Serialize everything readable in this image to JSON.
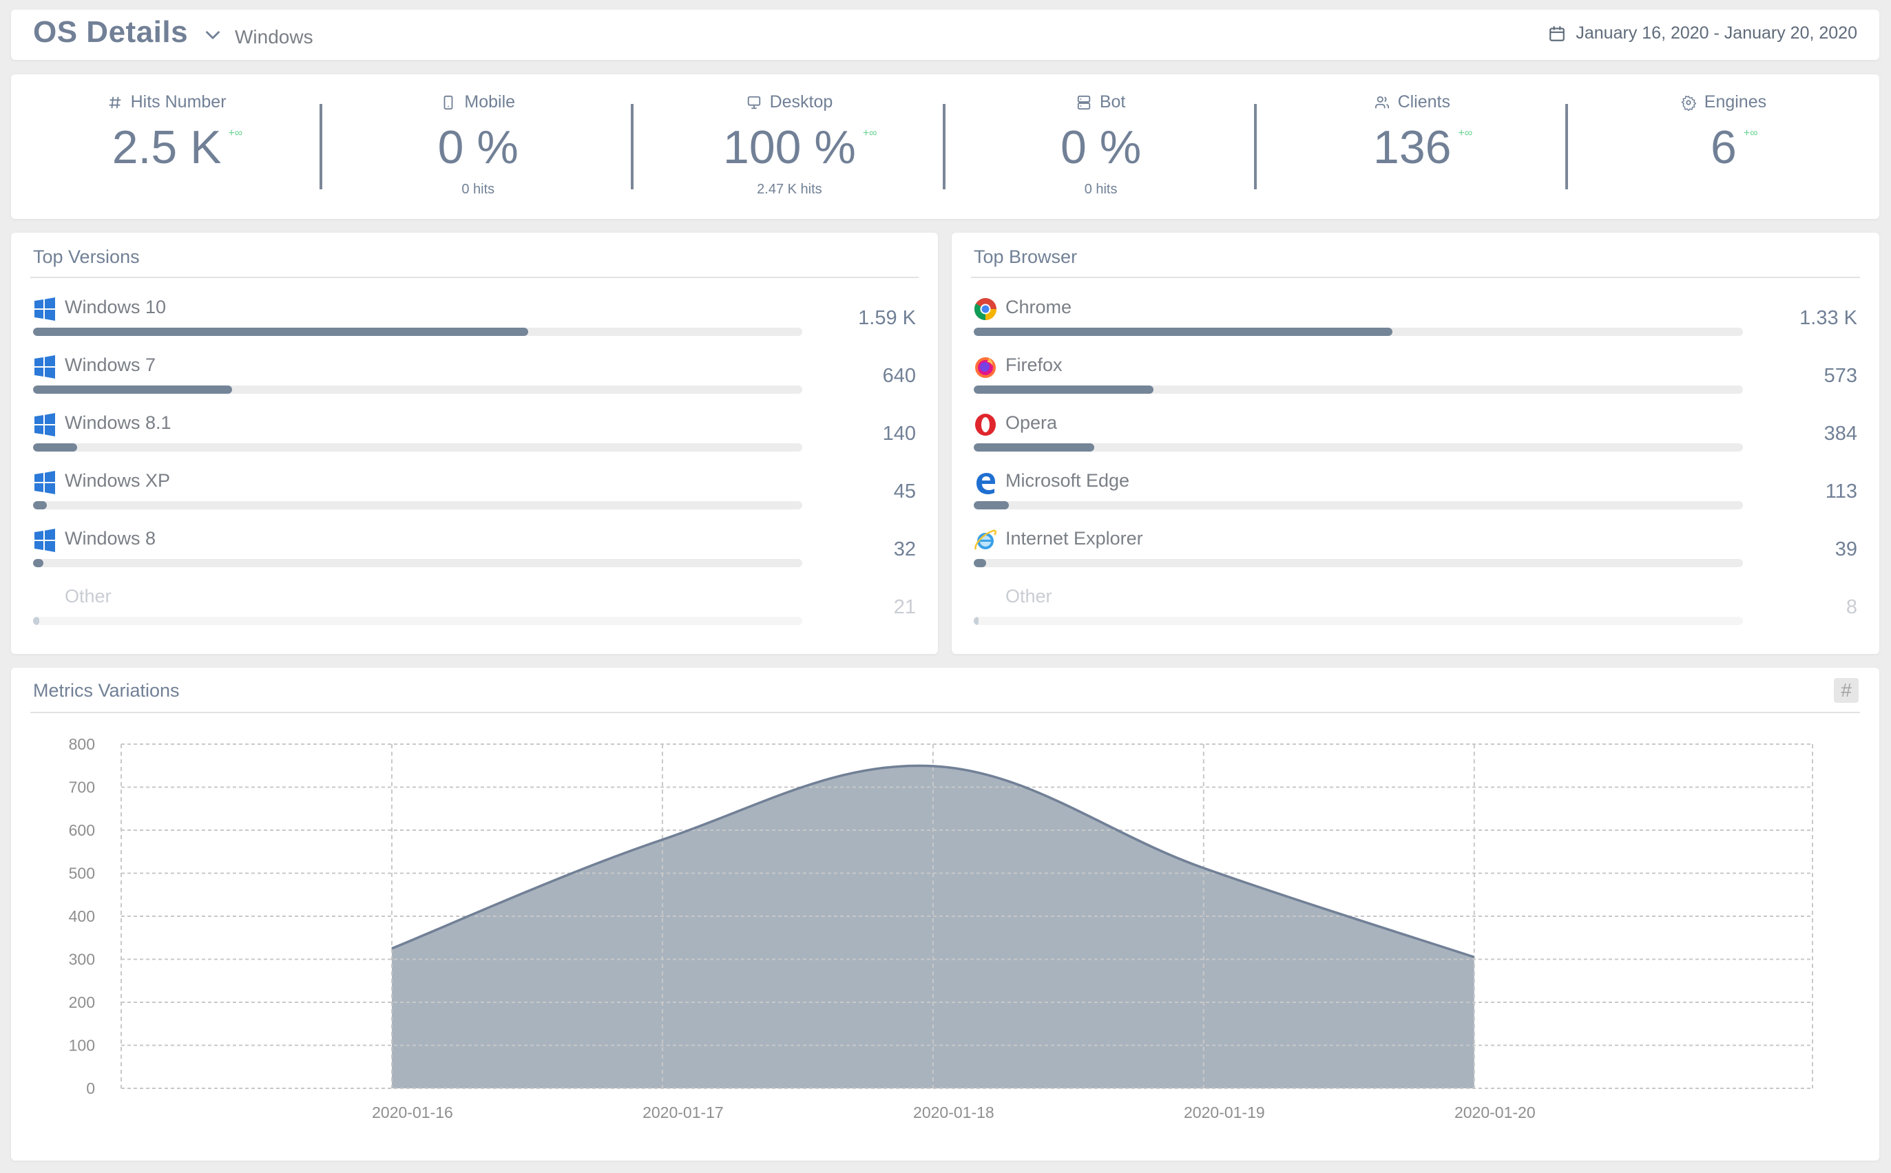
{
  "header": {
    "title": "OS Details",
    "selected_os": "Windows",
    "date_range": "January 16, 2020 - January 20, 2020"
  },
  "stats": [
    {
      "icon": "hash-icon",
      "label": "Hits Number",
      "value": "2.5 K",
      "trend": "+∞",
      "sub": ""
    },
    {
      "icon": "mobile-icon",
      "label": "Mobile",
      "value": "0 %",
      "trend": "",
      "sub": "0  hits"
    },
    {
      "icon": "desktop-icon",
      "label": "Desktop",
      "value": "100 %",
      "trend": "+∞",
      "sub": "2.47 K hits"
    },
    {
      "icon": "server-icon",
      "label": "Bot",
      "value": "0 %",
      "trend": "",
      "sub": "0  hits"
    },
    {
      "icon": "users-icon",
      "label": "Clients",
      "value": "136",
      "trend": "+∞",
      "sub": ""
    },
    {
      "icon": "gear-icon",
      "label": "Engines",
      "value": "6",
      "trend": "+∞",
      "sub": ""
    }
  ],
  "top_versions": {
    "title": "Top Versions",
    "items": [
      {
        "icon": "windows-icon",
        "label": "Windows 10",
        "value": "1.59 K",
        "fraction": 0.644
      },
      {
        "icon": "windows-icon",
        "label": "Windows 7",
        "value": "640",
        "fraction": 0.259
      },
      {
        "icon": "windows-icon",
        "label": "Windows 8.1",
        "value": "140",
        "fraction": 0.057
      },
      {
        "icon": "windows-icon",
        "label": "Windows XP",
        "value": "45",
        "fraction": 0.018
      },
      {
        "icon": "windows-icon",
        "label": "Windows 8",
        "value": "32",
        "fraction": 0.013
      },
      {
        "icon": "",
        "label": "Other",
        "value": "21",
        "fraction": 0.008,
        "other": true
      }
    ]
  },
  "top_browser": {
    "title": "Top Browser",
    "items": [
      {
        "icon": "chrome-icon",
        "label": "Chrome",
        "value": "1.33 K",
        "fraction": 0.544
      },
      {
        "icon": "firefox-icon",
        "label": "Firefox",
        "value": "573",
        "fraction": 0.234
      },
      {
        "icon": "opera-icon",
        "label": "Opera",
        "value": "384",
        "fraction": 0.157
      },
      {
        "icon": "edge-icon",
        "label": "Microsoft Edge",
        "value": "113",
        "fraction": 0.046
      },
      {
        "icon": "ie-icon",
        "label": "Internet Explorer",
        "value": "39",
        "fraction": 0.016
      },
      {
        "icon": "",
        "label": "Other",
        "value": "8",
        "fraction": 0.003,
        "other": true
      }
    ]
  },
  "metrics": {
    "title": "Metrics Variations",
    "toggle_label": "#"
  },
  "colors": {
    "accent": "#718096",
    "bar_fill": "#758598",
    "area_fill": "#a9b3be",
    "area_line": "#718096",
    "trend": "#68d391",
    "windows_blue": "#2b79d8"
  },
  "chart_data": {
    "type": "area",
    "title": "Metrics Variations",
    "xlabel": "",
    "ylabel": "",
    "categories": [
      "2020-01-16",
      "2020-01-17",
      "2020-01-18",
      "2020-01-19",
      "2020-01-20"
    ],
    "series": [
      {
        "name": "Hits",
        "values": [
          325,
          578,
          749,
          512,
          305
        ]
      }
    ],
    "ylim": [
      0,
      800
    ],
    "yticks": [
      0,
      100,
      200,
      300,
      400,
      500,
      600,
      700,
      800
    ],
    "grid": true,
    "legend": "none",
    "curve": "smooth"
  }
}
